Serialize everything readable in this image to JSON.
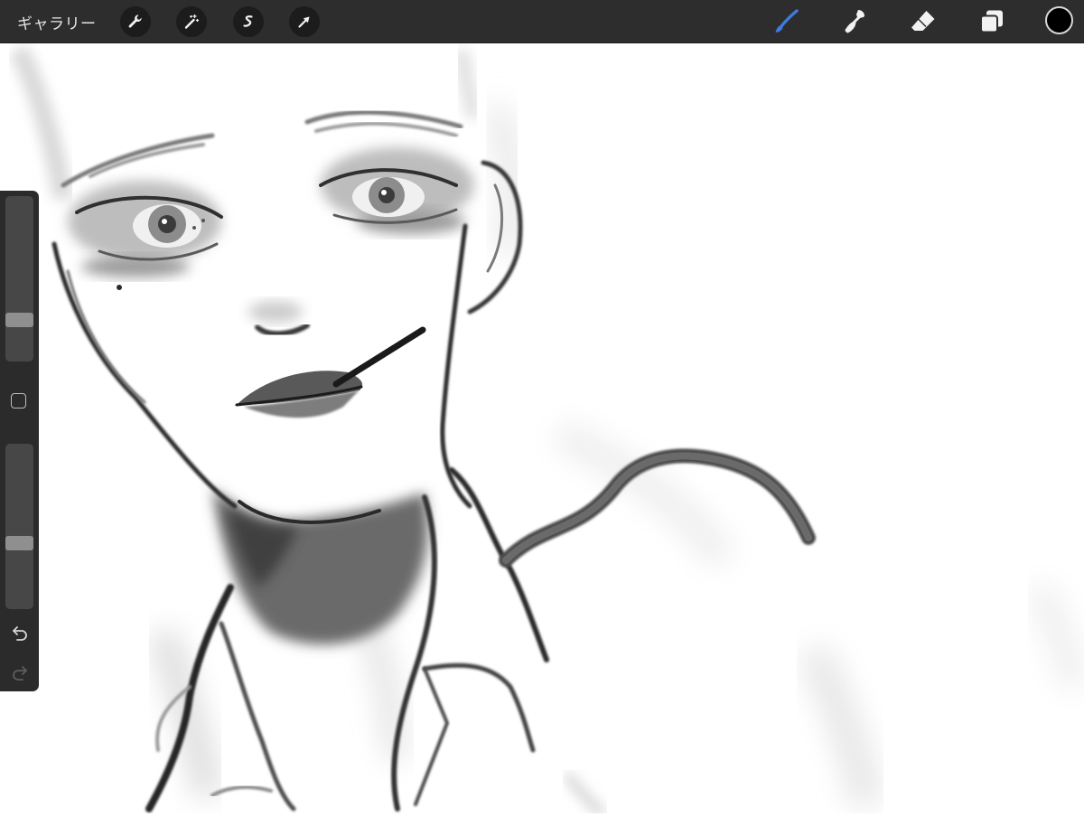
{
  "topbar": {
    "gallery_label": "ギャラリー",
    "left_tools": [
      {
        "name": "actions",
        "icon": "wrench-icon"
      },
      {
        "name": "adjustments",
        "icon": "magic-wand-icon"
      },
      {
        "name": "selection",
        "icon": "s-ribbon-icon"
      },
      {
        "name": "transform",
        "icon": "arrow-cursor-icon"
      }
    ],
    "right_tools": [
      {
        "name": "brush",
        "icon": "brush-icon",
        "active": true
      },
      {
        "name": "smudge",
        "icon": "smudge-finger-icon",
        "active": false
      },
      {
        "name": "eraser",
        "icon": "eraser-icon",
        "active": false
      },
      {
        "name": "layers",
        "icon": "layers-icon",
        "active": false
      }
    ],
    "current_color": "#000000"
  },
  "sidebar": {
    "brush_size_level": 0.23,
    "opacity_level": 0.39,
    "modify_icon": "square-icon",
    "undo_icon": "undo-arrow-icon",
    "redo_icon": "redo-arrow-icon"
  },
  "colors": {
    "toolbar_bg": "#2d2d2d",
    "active_tool": "#3d7be0",
    "inactive_tool": "#f2f2f2",
    "canvas_bg": "#ffffff"
  }
}
